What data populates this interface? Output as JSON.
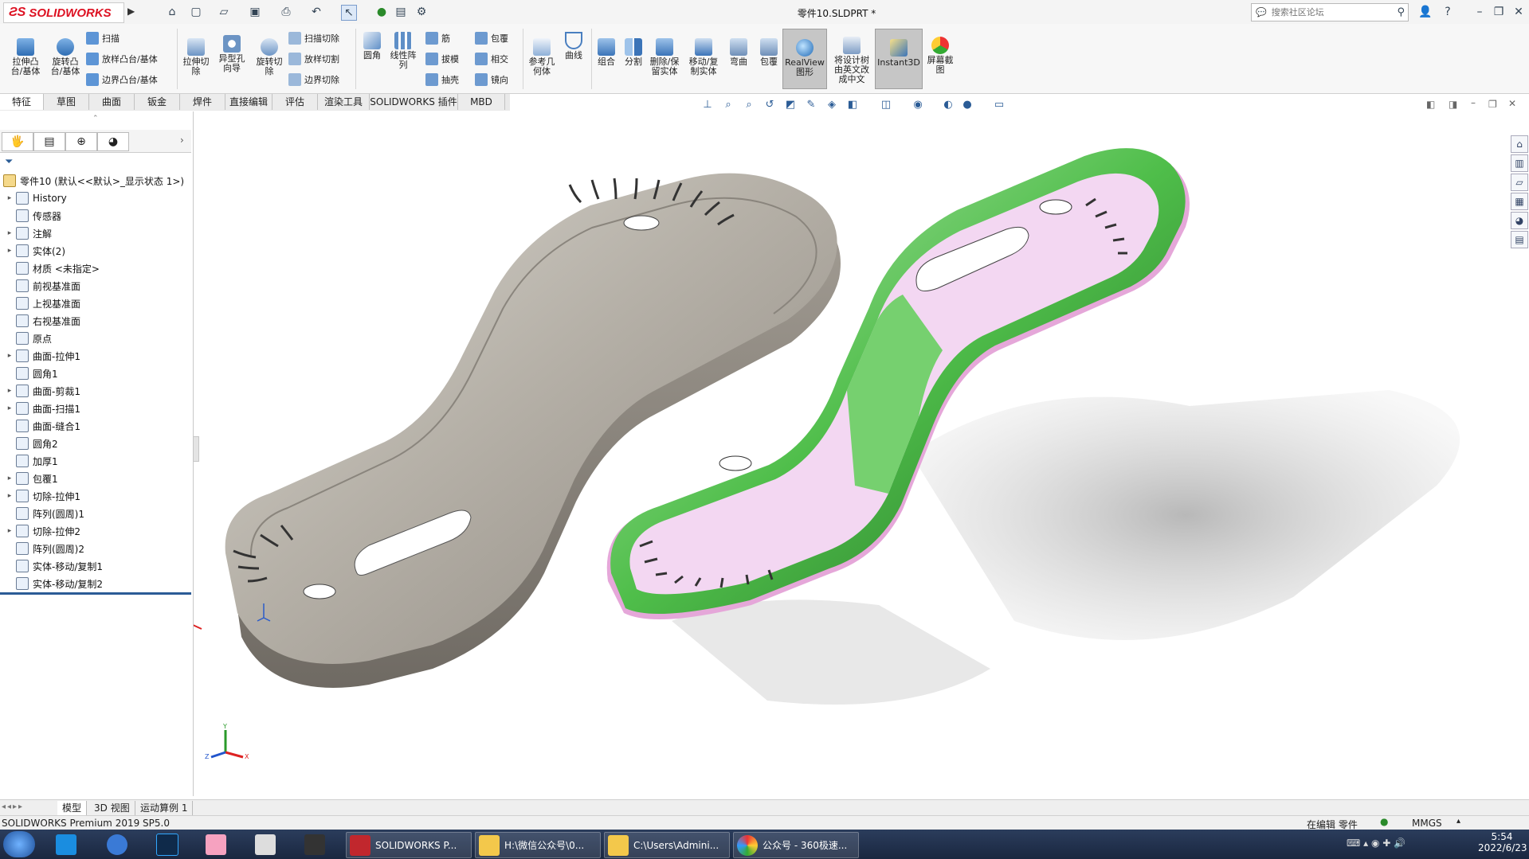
{
  "app": {
    "brand": "SOLIDWORKS",
    "document_title": "零件10.SLDPRT *"
  },
  "search": {
    "placeholder": "搜索社区论坛"
  },
  "titlebar_icons": [
    "home-icon",
    "new-icon",
    "open-icon",
    "save-icon",
    "print-icon",
    "undo-icon",
    "select-icon",
    "traffic-light-icon",
    "options-icon",
    "settings-icon"
  ],
  "commands": {
    "extrude_boss": "拉伸凸\n台/基体",
    "revolve_boss": "旋转凸\n台/基体",
    "sweep": "扫描",
    "loft_boss": "放样凸台/基体",
    "boundary_boss": "边界凸台/基体",
    "extrude_cut": "拉伸切\n除",
    "hole_wizard": "异型孔\n向导",
    "revolve_cut": "旋转切\n除",
    "sweep_cut": "扫描切除",
    "loft_cut": "放样切割",
    "boundary_cut": "边界切除",
    "fillet": "圆角",
    "linear_pattern": "线性阵\n列",
    "rib": "筋",
    "draft": "拔模",
    "shell": "抽壳",
    "wrap": "包覆",
    "intersect": "相交",
    "mirror": "镜向",
    "ref_geometry": "参考几\n何体",
    "curves": "曲线",
    "combine": "组合",
    "split": "分割",
    "delete_keep_body": "删除/保\n留实体",
    "move_copy": "移动/复\n制实体",
    "flex": "弯曲",
    "wrap2": "包覆",
    "realview": "RealView\n图形",
    "translate_tree": "将设计树\n由英文改\n成中文",
    "instant3d": "Instant3D",
    "screenshot": "屏幕截\n图"
  },
  "tabs": [
    "特征",
    "草图",
    "曲面",
    "钣金",
    "焊件",
    "直接编辑",
    "评估",
    "渲染工具",
    "SOLIDWORKS 插件",
    "MBD"
  ],
  "active_tab": "特征",
  "tree": {
    "root": "零件10  (默认<<默认>_显示状态 1>)",
    "items": [
      {
        "label": "History",
        "arrow": "▸"
      },
      {
        "label": "传感器",
        "arrow": ""
      },
      {
        "label": "注解",
        "arrow": "▸"
      },
      {
        "label": "实体(2)",
        "arrow": "▸"
      },
      {
        "label": "材质 <未指定>",
        "arrow": ""
      },
      {
        "label": "前视基准面",
        "arrow": ""
      },
      {
        "label": "上视基准面",
        "arrow": ""
      },
      {
        "label": "右视基准面",
        "arrow": ""
      },
      {
        "label": "原点",
        "arrow": ""
      },
      {
        "label": "曲面-拉伸1",
        "arrow": "▸"
      },
      {
        "label": "圆角1",
        "arrow": ""
      },
      {
        "label": "曲面-剪裁1",
        "arrow": "▸"
      },
      {
        "label": "曲面-扫描1",
        "arrow": "▸"
      },
      {
        "label": "曲面-缝合1",
        "arrow": ""
      },
      {
        "label": "圆角2",
        "arrow": ""
      },
      {
        "label": "加厚1",
        "arrow": ""
      },
      {
        "label": "包覆1",
        "arrow": "▸"
      },
      {
        "label": "切除-拉伸1",
        "arrow": "▸"
      },
      {
        "label": "阵列(圆周)1",
        "arrow": ""
      },
      {
        "label": "切除-拉伸2",
        "arrow": "▸"
      },
      {
        "label": "阵列(圆周)2",
        "arrow": ""
      },
      {
        "label": "实体-移动/复制1",
        "arrow": ""
      },
      {
        "label": "实体-移动/复制2",
        "arrow": ""
      }
    ]
  },
  "bottom_tabs": [
    "模型",
    "3D 视图",
    "运动算例 1"
  ],
  "status": {
    "product": "SOLIDWORKS Premium 2019 SP5.0",
    "mode": "在编辑 零件",
    "units": "MMGS"
  },
  "taskbar": {
    "apps": [
      {
        "label": "SOLIDWORKS P...",
        "icon": "solidworks-icon"
      },
      {
        "label": "H:\\微信公众号\\0...",
        "icon": "folder-icon"
      },
      {
        "label": "C:\\Users\\Admini...",
        "icon": "folder-icon"
      },
      {
        "label": "公众号 - 360极速...",
        "icon": "browser-icon"
      }
    ],
    "time": "5:54",
    "date": "2022/6/23"
  },
  "colors": {
    "accent": "#2b5c96",
    "brand": "#d71920",
    "shell_green": "#2fa33a",
    "shell_pink": "#f1d9f1",
    "metal": "#b9b4ac"
  }
}
